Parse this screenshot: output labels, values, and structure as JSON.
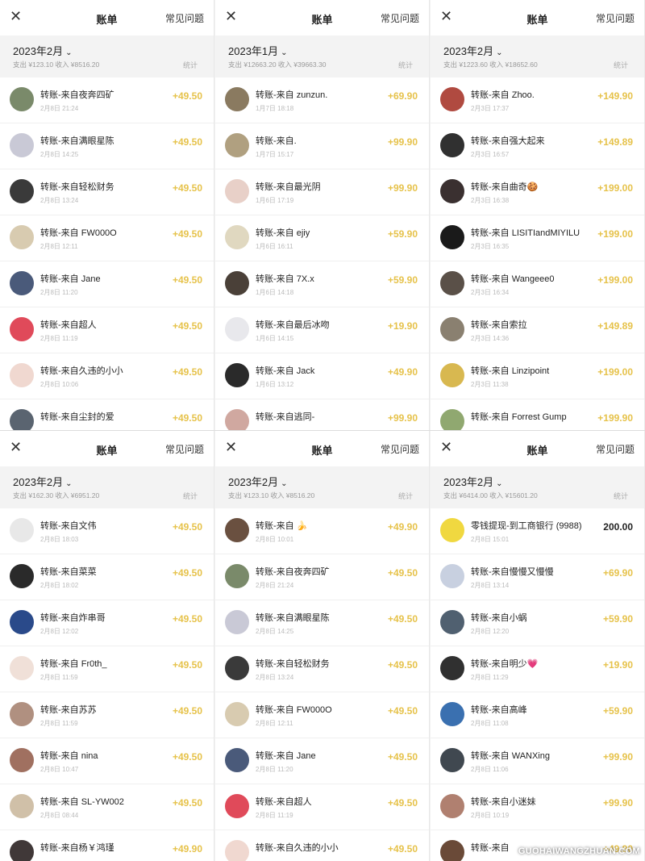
{
  "common": {
    "title": "账单",
    "faq": "常见问题",
    "stats": "统计",
    "close_glyph": "✕",
    "month_chev": "⌄"
  },
  "colors": {
    "income": "#e6c24a",
    "withdraw": "#222222"
  },
  "watermark": "GUOHAIWANGZHUAN.COM",
  "panels": [
    {
      "month": "2023年2月",
      "totals": "支出 ¥123.10 收入 ¥8516.20",
      "rows": [
        {
          "name": "转账-来自夜奔四矿",
          "time": "2月8日 21:24",
          "amount": "+49.50",
          "avatar": "#7a8a6a"
        },
        {
          "name": "转账-来自满眼星陈",
          "time": "2月8日 14:25",
          "amount": "+49.50",
          "avatar": "#c9c9d6"
        },
        {
          "name": "转账-来自轻松财务",
          "time": "2月8日 13:24",
          "amount": "+49.50",
          "avatar": "#3a3a3a"
        },
        {
          "name": "转账-来自 FW000O",
          "time": "2月8日 12:11",
          "amount": "+49.50",
          "avatar": "#d8cbb0"
        },
        {
          "name": "转账-来自 Jane",
          "time": "2月8日 11:20",
          "amount": "+49.50",
          "avatar": "#4a5a7a"
        },
        {
          "name": "转账-来自超人",
          "time": "2月8日 11:19",
          "amount": "+49.50",
          "avatar": "#e04a5a"
        },
        {
          "name": "转账-来自久违的小小",
          "time": "2月8日 10:06",
          "amount": "+49.50",
          "avatar": "#f0d8d0"
        },
        {
          "name": "转账-来自尘封的爱",
          "time": "",
          "amount": "+49.50",
          "avatar": "#5a6470"
        }
      ]
    },
    {
      "month": "2023年1月",
      "totals": "支出 ¥12663.20 收入 ¥39663.30",
      "rows": [
        {
          "name": "转账-来自 zunzun.",
          "time": "1月7日 18:18",
          "amount": "+69.90",
          "avatar": "#8a7a60"
        },
        {
          "name": "转账-来自.",
          "time": "1月7日 15:17",
          "amount": "+99.90",
          "avatar": "#b0a080"
        },
        {
          "name": "转账-来自最光阴",
          "time": "1月6日 17:19",
          "amount": "+99.90",
          "avatar": "#e8d0c8"
        },
        {
          "name": "转账-来自 ejiy",
          "time": "1月6日 16:11",
          "amount": "+59.90",
          "avatar": "#e0d8c0"
        },
        {
          "name": "转账-来自 7X.x",
          "time": "1月6日 14:18",
          "amount": "+59.90",
          "avatar": "#4a4038"
        },
        {
          "name": "转账-来自最后冰吻",
          "time": "1月6日 14:15",
          "amount": "+19.90",
          "avatar": "#e8e8ec"
        },
        {
          "name": "转账-来自 Jack",
          "time": "1月6日 13:12",
          "amount": "+49.90",
          "avatar": "#2a2a2a"
        },
        {
          "name": "转账-来自逃同-",
          "time": "",
          "amount": "+99.90",
          "avatar": "#d0a8a0"
        }
      ]
    },
    {
      "month": "2023年2月",
      "totals": "支出 ¥1223.60 收入 ¥18652.60",
      "rows": [
        {
          "name": "转账-来自 Zhoo.",
          "time": "2月3日 17:37",
          "amount": "+149.90",
          "avatar": "#b04a40"
        },
        {
          "name": "转账-来自强大起来",
          "time": "2月3日 16:57",
          "amount": "+149.89",
          "avatar": "#303030"
        },
        {
          "name": "转账-来自曲奇🍪",
          "time": "2月3日 16:38",
          "amount": "+199.00",
          "avatar": "#3a3030"
        },
        {
          "name": "转账-来自 LISITIandMIYILU",
          "time": "2月3日 16:35",
          "amount": "+199.00",
          "avatar": "#1a1a1a"
        },
        {
          "name": "转账-来自 Wangeee0",
          "time": "2月3日 16:34",
          "amount": "+199.00",
          "avatar": "#5a5048"
        },
        {
          "name": "转账-来自索拉",
          "time": "2月3日 14:36",
          "amount": "+149.89",
          "avatar": "#8a8070"
        },
        {
          "name": "转账-来自 Linzipoint",
          "time": "2月3日 11:38",
          "amount": "+199.00",
          "avatar": "#d8b850"
        },
        {
          "name": "转账-来自 Forrest Gump",
          "time": "",
          "amount": "+199.90",
          "avatar": "#90a870"
        }
      ]
    },
    {
      "month": "2023年2月",
      "totals": "支出 ¥162.30 收入 ¥6951.20",
      "rows": [
        {
          "name": "转账-来自文伟",
          "time": "2月8日 18:03",
          "amount": "+49.50",
          "avatar": "#e8e8e8"
        },
        {
          "name": "转账-来自菜菜",
          "time": "2月8日 18:02",
          "amount": "+49.50",
          "avatar": "#2a2a2a"
        },
        {
          "name": "转账-来自炸串哥",
          "time": "2月8日 12:02",
          "amount": "+49.50",
          "avatar": "#2a4a8a"
        },
        {
          "name": "转账-来自 Fr0th_",
          "time": "2月8日 11:59",
          "amount": "+49.50",
          "avatar": "#f0e0d8"
        },
        {
          "name": "转账-来自苏苏",
          "time": "2月8日 11:59",
          "amount": "+49.50",
          "avatar": "#b09080"
        },
        {
          "name": "转账-来自 nina",
          "time": "2月8日 10:47",
          "amount": "+49.50",
          "avatar": "#a07060"
        },
        {
          "name": "转账-来自 SL-YW002",
          "time": "2月8日 08:44",
          "amount": "+49.50",
          "avatar": "#d0c0a8"
        },
        {
          "name": "转账-来自杨￥鸿瑾",
          "time": "",
          "amount": "+49.90",
          "avatar": "#403838"
        }
      ]
    },
    {
      "month": "2023年2月",
      "totals": "支出 ¥123.10 收入 ¥8516.20",
      "rows": [
        {
          "name": "转账-来自 🍌",
          "time": "2月8日 10:01",
          "amount": "+49.90",
          "avatar": "#6a5040"
        },
        {
          "name": "转账-来自夜奔四矿",
          "time": "2月8日 21:24",
          "amount": "+49.50",
          "avatar": "#7a8a6a"
        },
        {
          "name": "转账-来自满眼星陈",
          "time": "2月8日 14:25",
          "amount": "+49.50",
          "avatar": "#c9c9d6"
        },
        {
          "name": "转账-来自轻松财务",
          "time": "2月8日 13:24",
          "amount": "+49.50",
          "avatar": "#3a3a3a"
        },
        {
          "name": "转账-来自 FW000O",
          "time": "2月8日 12:11",
          "amount": "+49.50",
          "avatar": "#d8cbb0"
        },
        {
          "name": "转账-来自 Jane",
          "time": "2月8日 11:20",
          "amount": "+49.50",
          "avatar": "#4a5a7a"
        },
        {
          "name": "转账-来自超人",
          "time": "2月8日 11:19",
          "amount": "+49.50",
          "avatar": "#e04a5a"
        },
        {
          "name": "转账-来自久违的小小",
          "time": "",
          "amount": "+49.50",
          "avatar": "#f0d8d0"
        }
      ]
    },
    {
      "month": "2023年2月",
      "totals": "支出 ¥6414.00 收入 ¥15601.20",
      "rows": [
        {
          "name": "零钱提现-到工商银行 (9988)",
          "time": "2月8日 15:01",
          "amount": "200.00",
          "avatar": "#f0d840",
          "dark": true
        },
        {
          "name": "转账-来自慢慢又慢慢",
          "time": "2月8日 13:14",
          "amount": "+69.90",
          "avatar": "#c8d0e0"
        },
        {
          "name": "转账-来自小蜗",
          "time": "2月8日 12:20",
          "amount": "+59.90",
          "avatar": "#506070"
        },
        {
          "name": "转账-来自明少💗",
          "time": "2月8日 11:29",
          "amount": "+19.90",
          "avatar": "#303030"
        },
        {
          "name": "转账-来自高峰",
          "time": "2月8日 11:08",
          "amount": "+59.90",
          "avatar": "#3a70b0"
        },
        {
          "name": "转账-来自 WANXing",
          "time": "2月8日 11:06",
          "amount": "+99.90",
          "avatar": "#404850"
        },
        {
          "name": "转账-来自小迷妹",
          "time": "2月8日 10:19",
          "amount": "+99.90",
          "avatar": "#b08070"
        },
        {
          "name": "转账-来自",
          "time": "",
          "amount": "+49.90",
          "avatar": "#6a4a38"
        }
      ]
    }
  ]
}
